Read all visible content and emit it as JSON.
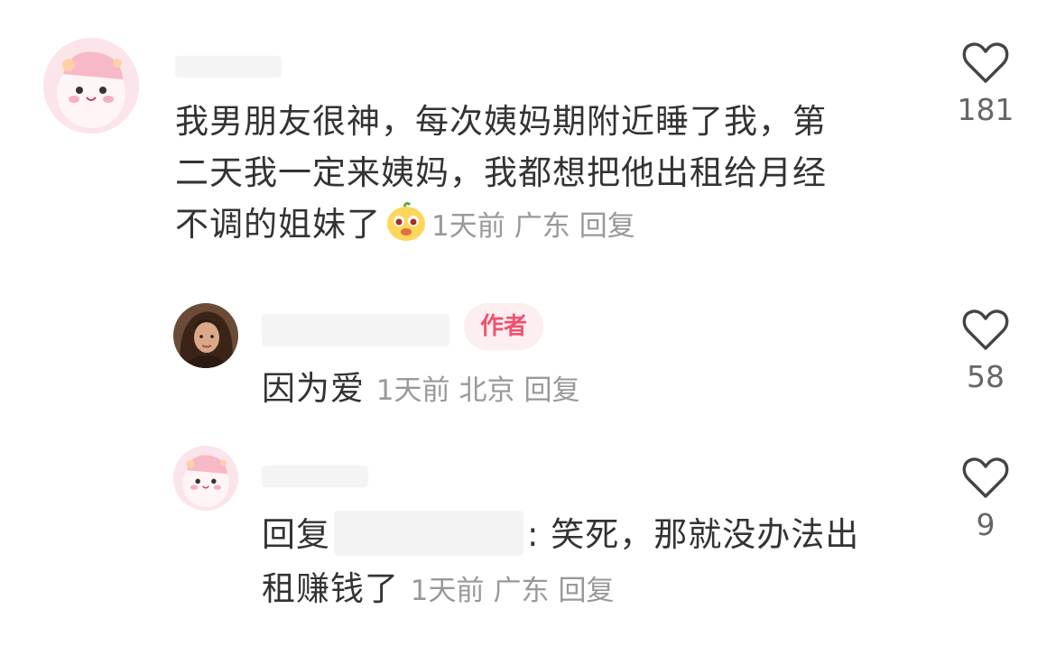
{
  "comments": [
    {
      "text": "我男朋友很神，每次姨妈期附近睡了我，第二天我一定来姨妈，我都想把他出租给月经不调的姐妹了",
      "line1": "我男朋友很神，每次姨妈期附近睡了我，第",
      "line2": "二天我一定来姨妈，我都想把他出租给月经",
      "line3": "不调的姐妹了",
      "emoji": "happy-face-emoji",
      "time": "1天前",
      "location": "广东",
      "reply_label": "回复",
      "likes": "181"
    },
    {
      "badge": "作者",
      "text": "因为爱",
      "time": "1天前",
      "location": "北京",
      "reply_label": "回复",
      "likes": "58"
    },
    {
      "reply_prefix": "回复",
      "reply_colon": ": ",
      "line1_rest": "笑死，那就没办法出",
      "line2": "租赚钱了",
      "time": "1天前",
      "location": "广东",
      "reply_label": "回复",
      "likes": "9"
    }
  ],
  "icons": {
    "like": "heart-outline-icon",
    "avatar1": "cartoon-pink-avatar",
    "avatar2": "photo-avatar",
    "avatar3": "cartoon-pink-avatar"
  },
  "colors": {
    "text": "#333333",
    "meta": "#999999",
    "badge_bg": "#fdeef0",
    "badge_text": "#f0506e"
  }
}
